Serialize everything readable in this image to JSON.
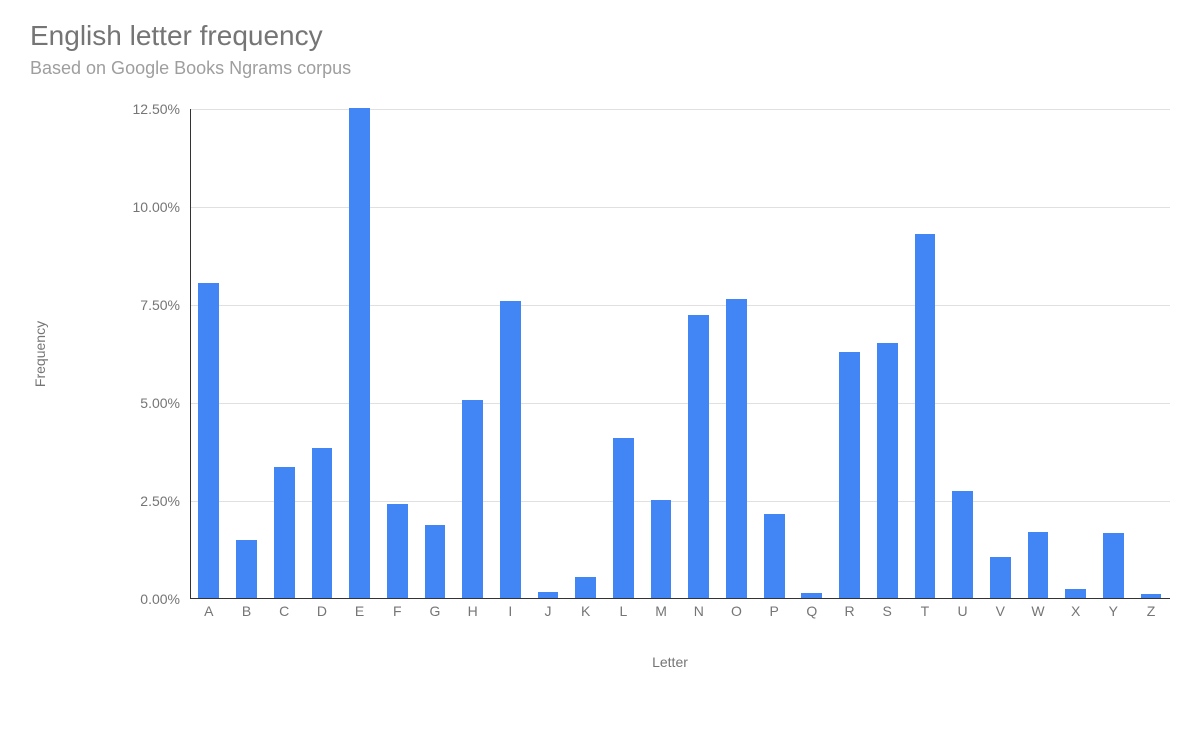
{
  "chart_data": {
    "type": "bar",
    "title": "English letter frequency",
    "subtitle": "Based on Google Books Ngrams corpus",
    "xlabel": "Letter",
    "ylabel": "Frequency",
    "ylim": [
      0,
      12.5
    ],
    "y_ticks": [
      "0.00%",
      "2.50%",
      "5.00%",
      "7.50%",
      "10.00%",
      "12.50%"
    ],
    "categories": [
      "A",
      "B",
      "C",
      "D",
      "E",
      "F",
      "G",
      "H",
      "I",
      "J",
      "K",
      "L",
      "M",
      "N",
      "O",
      "P",
      "Q",
      "R",
      "S",
      "T",
      "U",
      "V",
      "W",
      "X",
      "Y",
      "Z"
    ],
    "values": [
      8.04,
      1.48,
      3.34,
      3.82,
      12.49,
      2.4,
      1.87,
      5.05,
      7.57,
      0.16,
      0.54,
      4.07,
      2.51,
      7.23,
      7.64,
      2.14,
      0.12,
      6.28,
      6.51,
      9.28,
      2.73,
      1.05,
      1.68,
      0.23,
      1.66,
      0.09
    ],
    "bar_color": "#4285f4"
  }
}
